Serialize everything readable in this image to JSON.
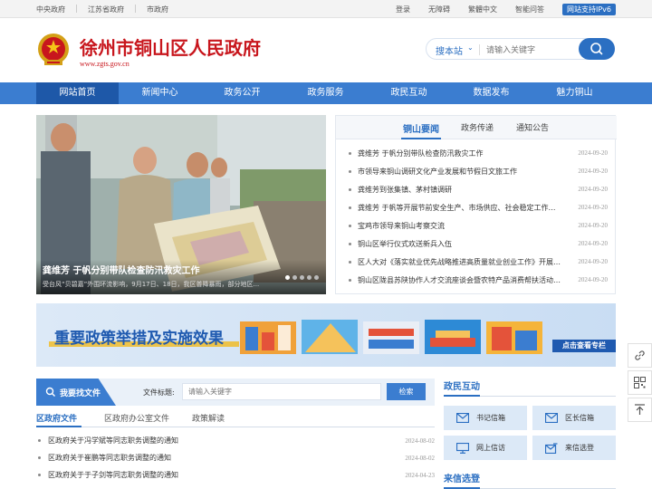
{
  "topbar": {
    "left": [
      "中央政府",
      "江苏省政府",
      "市政府"
    ],
    "right": [
      "登录",
      "无障碍",
      "繁體中文",
      "智能问答"
    ],
    "ipv6": "网站支持IPv6"
  },
  "header": {
    "title": "徐州市铜山区人民政府",
    "url": "www.zgts.gov.cn",
    "search_label": "搜本站",
    "search_placeholder": "请输入关键字"
  },
  "nav": [
    "网站首页",
    "新闻中心",
    "政务公开",
    "政务服务",
    "政民互动",
    "数据发布",
    "魅力铜山"
  ],
  "slider": {
    "caption": "龚维芳 于帆分别带队检查防汛救灾工作",
    "subcaption": "受台风“贝碧嘉”外围环流影响，9月17日、18日，我区普降暴雨，部分地区..."
  },
  "news": {
    "tabs": [
      "铜山要闻",
      "政务传递",
      "通知公告"
    ],
    "items": [
      {
        "title": "龚维芳 于帆分别带队检查防汛救灾工作",
        "date": "2024-09-20"
      },
      {
        "title": "市领导来铜山调研文化产业发展和节假日文旅工作",
        "date": "2024-09-20"
      },
      {
        "title": "龚维芳到张集镇、茅村镇调研",
        "date": "2024-09-20"
      },
      {
        "title": "龚维芳 于帆等开展节前安全生产、市场供应、社会稳定工作督查",
        "date": "2024-09-20"
      },
      {
        "title": "宝鸡市领导来铜山考察交流",
        "date": "2024-09-20"
      },
      {
        "title": "铜山区举行仪式欢送新兵入伍",
        "date": "2024-09-20"
      },
      {
        "title": "区人大对《落实就业优先战略推进高质量就业创业工作》开展专题询问",
        "date": "2024-09-20"
      },
      {
        "title": "铜山区陇县苏陕协作人才交流座谈会暨农特产品消费帮扶活动举行",
        "date": "2024-09-20"
      }
    ]
  },
  "banner": {
    "title": "重要政策举措及实施效果",
    "more": "点击查看专栏"
  },
  "find": {
    "badge": "我要找文件",
    "label": "文件标题:",
    "placeholder": "请输入关键字",
    "button": "检索"
  },
  "doc_tabs": [
    "区政府文件",
    "区政府办公室文件",
    "政策解读"
  ],
  "docs": [
    {
      "title": "区政府关于冯学斌等同志职务调整的通知",
      "date": "2024-08-02"
    },
    {
      "title": "区政府关于崔鹏等同志职务调整的通知",
      "date": "2024-08-02"
    },
    {
      "title": "区政府关于于子剑等同志职务调整的通知",
      "date": "2024-04-23"
    }
  ],
  "interaction": {
    "title": "政民互动",
    "cards": [
      "书记信箱",
      "区长信箱",
      "网上信访",
      "来信选登"
    ],
    "section2": "来信选登"
  },
  "colors": {
    "brand_red": "#c8161d",
    "nav_blue": "#3b7dd0",
    "accent_blue": "#2b6fc2"
  }
}
